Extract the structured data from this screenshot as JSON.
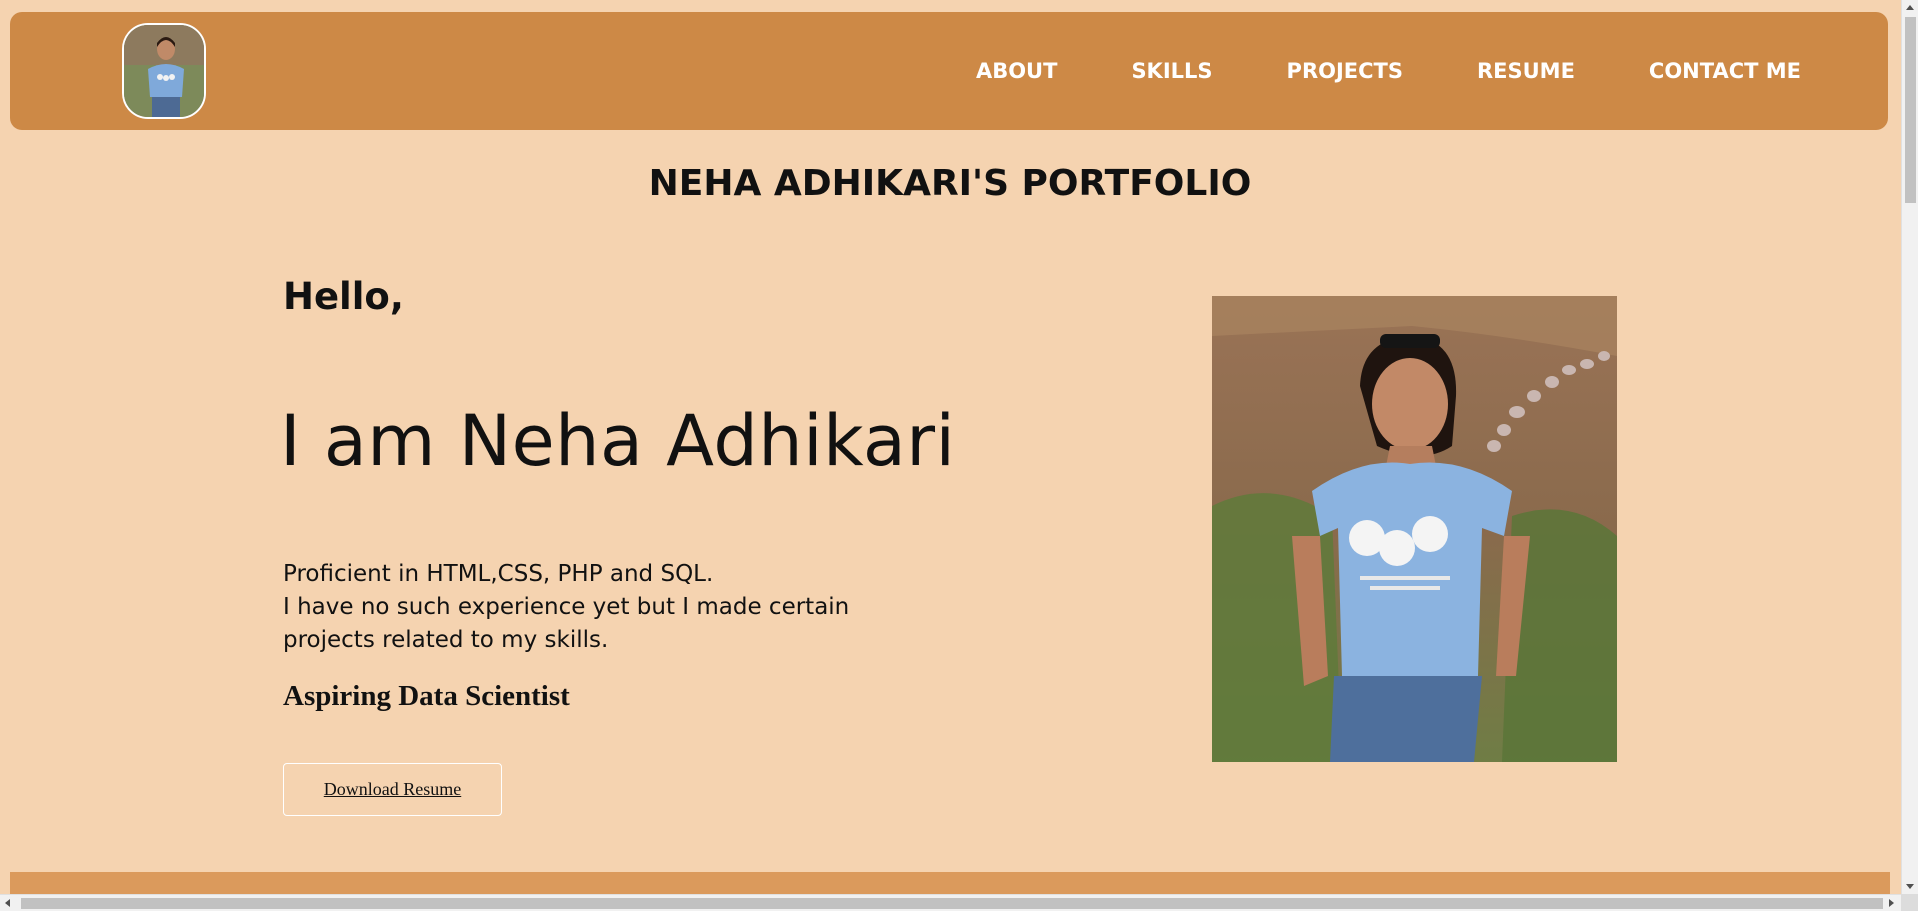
{
  "header": {
    "logo_alt": "profile-avatar",
    "nav": [
      {
        "label": "ABOUT"
      },
      {
        "label": "SKILLS"
      },
      {
        "label": "PROJECTS"
      },
      {
        "label": "RESUME"
      },
      {
        "label": "CONTACT ME"
      }
    ]
  },
  "main": {
    "title": "NEHA ADHIKARI'S PORTFOLIO",
    "greeting": "Hello,",
    "intro": "I am Neha Adhikari",
    "description_lines": [
      "Proficient in HTML,CSS, PHP and SQL.",
      "I have no such experience yet but I made certain",
      "projects related to my skills."
    ],
    "role": "Aspiring Data Scientist",
    "download_label": "Download Resume"
  },
  "colors": {
    "page_bg": "#f5d3b0",
    "header_bg": "#cd8946",
    "bottom_band": "#db9a5c",
    "nav_text": "#ffffff"
  }
}
